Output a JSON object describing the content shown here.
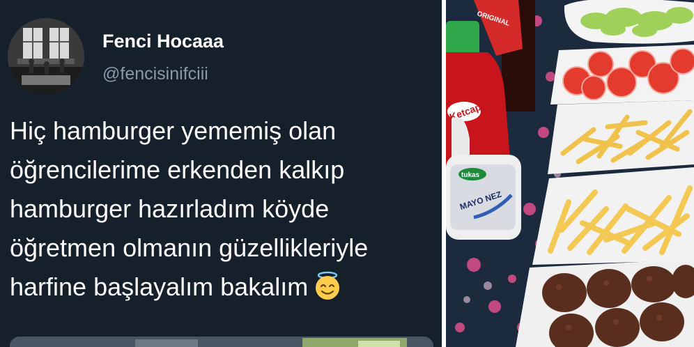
{
  "tweet": {
    "display_name": "Fenci Hocaaa",
    "handle": "@fencisinifciii",
    "text_lines": [
      "Hiç hamburger yememiş olan",
      "öğrencilerime erkenden kalkıp",
      "hamburger hazırladım köyde",
      "öğretmen olmanın güzellikleriyle",
      "harfine başlayalım bakalım"
    ],
    "emoji_icon": "smiling-face-with-halo-icon"
  },
  "photo": {
    "labels": {
      "ketchup_brand": "ORIGINAL",
      "ketchup_text": "Ketcap",
      "mayo_brand": "tukas",
      "mayo_name": "MAYO NEZ"
    }
  },
  "colors": {
    "tweet_background": "#15202b",
    "handle_gray": "#8b98a5",
    "ketchup_red": "#c8151b",
    "tablecloth": "#1c2a3d"
  }
}
